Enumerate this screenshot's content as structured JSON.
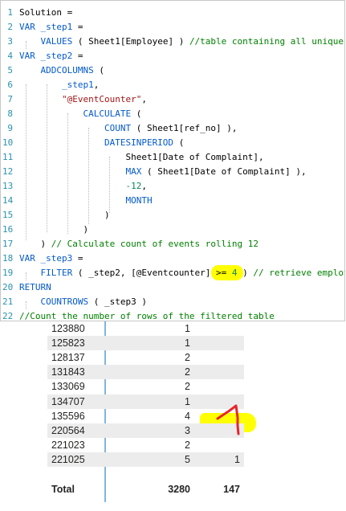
{
  "editor": {
    "lines": [
      {
        "n": "1",
        "tokens": [
          {
            "t": "Solution =",
            "c": "plain"
          }
        ]
      },
      {
        "n": "2",
        "tokens": [
          {
            "t": "VAR ",
            "c": "kw"
          },
          {
            "t": "_step1 ",
            "c": "kw"
          },
          {
            "t": "=",
            "c": "plain"
          }
        ]
      },
      {
        "n": "3",
        "tokens": [
          {
            "t": "    VALUES ",
            "c": "kw"
          },
          {
            "t": "( Sheet1[Employee] ) ",
            "c": "plain"
          },
          {
            "t": "//table containing all unique",
            "c": "cmt"
          }
        ]
      },
      {
        "n": "4",
        "tokens": [
          {
            "t": "VAR ",
            "c": "kw"
          },
          {
            "t": "_step2 ",
            "c": "kw"
          },
          {
            "t": "=",
            "c": "plain"
          }
        ]
      },
      {
        "n": "5",
        "tokens": [
          {
            "t": "    ADDCOLUMNS ",
            "c": "kw"
          },
          {
            "t": "(",
            "c": "plain"
          }
        ]
      },
      {
        "n": "6",
        "tokens": [
          {
            "t": "        _step1",
            "c": "kw"
          },
          {
            "t": ",",
            "c": "plain"
          }
        ]
      },
      {
        "n": "7",
        "tokens": [
          {
            "t": "        \"@EventCounter\"",
            "c": "str"
          },
          {
            "t": ",",
            "c": "plain"
          }
        ]
      },
      {
        "n": "8",
        "tokens": [
          {
            "t": "            CALCULATE ",
            "c": "kw"
          },
          {
            "t": "(",
            "c": "plain"
          }
        ]
      },
      {
        "n": "9",
        "tokens": [
          {
            "t": "                COUNT ",
            "c": "kw"
          },
          {
            "t": "( Sheet1[ref_no] ),",
            "c": "plain"
          }
        ]
      },
      {
        "n": "10",
        "tokens": [
          {
            "t": "                DATESINPERIOD ",
            "c": "kw"
          },
          {
            "t": "(",
            "c": "plain"
          }
        ]
      },
      {
        "n": "11",
        "tokens": [
          {
            "t": "                    Sheet1[Date of Complaint],",
            "c": "plain"
          }
        ]
      },
      {
        "n": "12",
        "tokens": [
          {
            "t": "                    MAX ",
            "c": "kw"
          },
          {
            "t": "( Sheet1[Date of Complaint] ),",
            "c": "plain"
          }
        ]
      },
      {
        "n": "13",
        "tokens": [
          {
            "t": "                    -12",
            "c": "nm"
          },
          {
            "t": ",",
            "c": "plain"
          }
        ]
      },
      {
        "n": "14",
        "tokens": [
          {
            "t": "                    MONTH",
            "c": "kw"
          }
        ]
      },
      {
        "n": "15",
        "tokens": [
          {
            "t": "                )",
            "c": "plain"
          }
        ]
      },
      {
        "n": "16",
        "tokens": [
          {
            "t": "            )",
            "c": "plain"
          }
        ]
      },
      {
        "n": "17",
        "tokens": [
          {
            "t": "    ) ",
            "c": "plain"
          },
          {
            "t": "// Calculate count of events rolling 12",
            "c": "cmt"
          }
        ]
      },
      {
        "n": "18",
        "tokens": [
          {
            "t": "VAR ",
            "c": "kw"
          },
          {
            "t": "_step3 ",
            "c": "kw"
          },
          {
            "t": "=",
            "c": "plain"
          }
        ]
      },
      {
        "n": "19",
        "tokens": [
          {
            "t": "    FILTER ",
            "c": "kw"
          },
          {
            "t": "( _step2, [@Eventcounter] ",
            "c": "plain"
          },
          {
            "t": ">= ",
            "c": "plain"
          },
          {
            "t": "4",
            "c": "nm"
          },
          {
            "t": " ) ",
            "c": "plain"
          },
          {
            "t": "// retrieve employ",
            "c": "cmt"
          }
        ]
      },
      {
        "n": "20",
        "tokens": [
          {
            "t": "RETURN",
            "c": "kw"
          }
        ]
      },
      {
        "n": "21",
        "tokens": [
          {
            "t": "    COUNTROWS ",
            "c": "kw"
          },
          {
            "t": "( _step3 )",
            "c": "plain"
          }
        ]
      },
      {
        "n": "22",
        "tokens": [
          {
            "t": "//Count the number of rows of the filtered table",
            "c": "cmt"
          }
        ]
      }
    ]
  },
  "table": {
    "rows": [
      {
        "employee": "123880",
        "count": "1",
        "solution": ""
      },
      {
        "employee": "125823",
        "count": "1",
        "solution": ""
      },
      {
        "employee": "128137",
        "count": "2",
        "solution": ""
      },
      {
        "employee": "131843",
        "count": "2",
        "solution": ""
      },
      {
        "employee": "133069",
        "count": "2",
        "solution": ""
      },
      {
        "employee": "134707",
        "count": "1",
        "solution": ""
      },
      {
        "employee": "135596",
        "count": "4",
        "solution": ""
      },
      {
        "employee": "220564",
        "count": "3",
        "solution": ""
      },
      {
        "employee": "221023",
        "count": "2",
        "solution": ""
      },
      {
        "employee": "221025",
        "count": "5",
        "solution": "1"
      }
    ],
    "total": {
      "label": "Total",
      "count": "3280",
      "solution": "147"
    }
  },
  "colors": {
    "highlight": "#ffff00",
    "annotation": "#e8262c",
    "divider": "#7fb6e0"
  }
}
